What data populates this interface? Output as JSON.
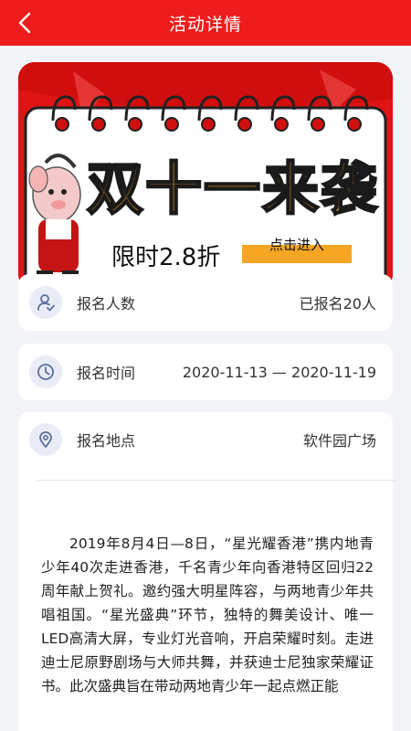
{
  "header": {
    "title": "活动详情",
    "back_icon": "chevron-left-icon"
  },
  "banner": {
    "headline": "双十一来袭",
    "discount": "限时2.8折",
    "cta": "点击进入",
    "colors": {
      "background": "#e01414",
      "paper": "#ffffff",
      "ribbon": "#f6a623"
    }
  },
  "info": {
    "signup_count": {
      "label": "报名人数",
      "value": "已报名20人",
      "icon": "user-check-icon"
    },
    "signup_time": {
      "label": "报名时间",
      "value": "2020-11-13 — 2020-11-19",
      "icon": "clock-icon"
    },
    "signup_place": {
      "label": "报名地点",
      "value": "软件园广场",
      "icon": "location-pin-icon"
    }
  },
  "description": "2019年8月4日—8日，“星光耀香港”携内地青少年40次走进香港，千名青少年向香港特区回归22周年献上贺礼。邀约强大明星阵容，与两地青少年共唱祖国。“星光盛典”环节，独特的舞美设计、唯一LED高清大屏，专业灯光音响，开启荣耀时刻。走进迪士尼原野剧场与大师共舞，并获迪士尼独家荣耀证书。此次盛典旨在带动两地青少年一起点燃正能",
  "theme": {
    "accent": "#ee1c1c",
    "icon_bg": "#e9ecf6",
    "icon_color": "#5b6f9e"
  }
}
